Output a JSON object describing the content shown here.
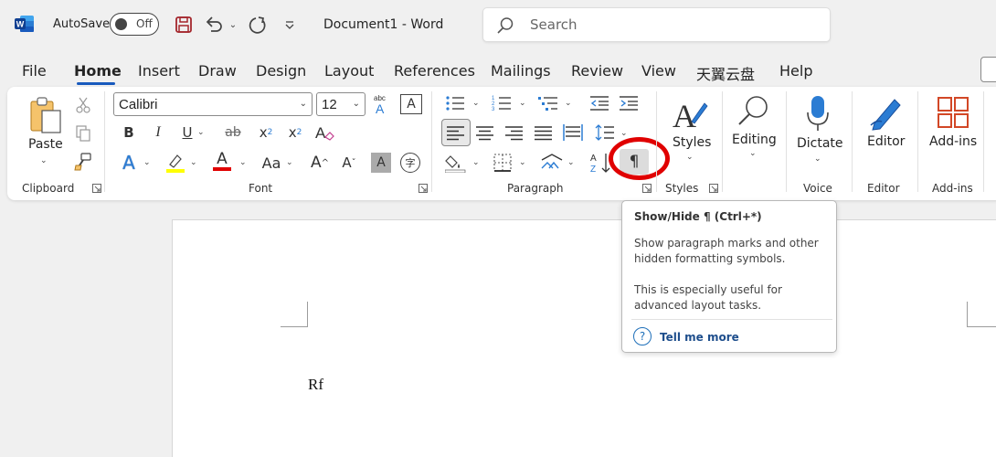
{
  "titlebar": {
    "app_icon_letter": "W",
    "autosave_label": "AutoSave",
    "autosave_state": "Off",
    "document_title": "Document1",
    "separator": "-",
    "app_name": "Word",
    "search_placeholder": "Search"
  },
  "menu_tabs": [
    {
      "label": "File"
    },
    {
      "label": "Home"
    },
    {
      "label": "Insert"
    },
    {
      "label": "Draw"
    },
    {
      "label": "Design"
    },
    {
      "label": "Layout"
    },
    {
      "label": "References"
    },
    {
      "label": "Mailings"
    },
    {
      "label": "Review"
    },
    {
      "label": "View"
    },
    {
      "label": "天翼云盘"
    },
    {
      "label": "Help"
    }
  ],
  "active_tab": "Home",
  "ribbon": {
    "clipboard": {
      "paste_label": "Paste",
      "group_label": "Clipboard"
    },
    "font": {
      "font_name": "Calibri",
      "font_size": "12",
      "group_label": "Font",
      "bold": "B",
      "italic": "I",
      "underline": "U",
      "strike": "ab",
      "subscript": "x",
      "subscript_mark": "2",
      "superscript": "x",
      "superscript_mark": "2",
      "change_case": "Aa",
      "grow_font": "A",
      "shrink_font": "A",
      "spelling_mark": "abc",
      "clear_formatting": "A",
      "text_effects": "A",
      "font_color": "A",
      "shading": "A",
      "enclose": "字"
    },
    "paragraph": {
      "group_label": "Paragraph",
      "show_hide_symbol": "¶",
      "sort_label": "A↓"
    },
    "styles": {
      "label": "Styles",
      "group_label": "Styles"
    },
    "editing": {
      "label": "Editing"
    },
    "voice": {
      "label": "Dictate",
      "group_label": "Voice"
    },
    "editor": {
      "label": "Editor",
      "group_label": "Editor"
    },
    "addins": {
      "label": "Add-ins",
      "group_label": "Add-ins"
    }
  },
  "tooltip": {
    "title": "Show/Hide ¶ (Ctrl+*)",
    "body_line1": "Show paragraph marks and other",
    "body_line2": "hidden formatting symbols.",
    "body_line3": "This is especially useful for",
    "body_line4": "advanced layout tasks.",
    "help_symbol": "?",
    "link": "Tell me more"
  },
  "document": {
    "text": "Rf"
  },
  "colors": {
    "accent": "#185abd",
    "highlight_bar": "#ffff00",
    "font_color_bar": "#e00000",
    "annotation_circle": "#e00000"
  }
}
